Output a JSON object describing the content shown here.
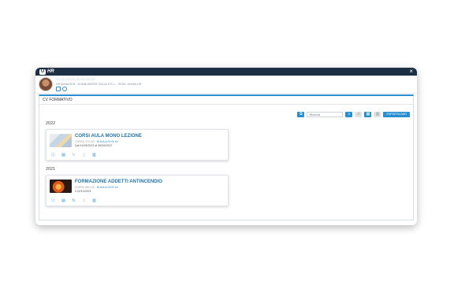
{
  "app": {
    "logo_mark": "U",
    "logo_text": "HR",
    "close": "×"
  },
  "profile": {
    "name": "— — — — — — — —",
    "meta": "HR MANAGER - BOMBONIERIE SALVA S.R.L. - SEDE: ADMIN HR"
  },
  "section": {
    "title": "CV FORMATIVO"
  },
  "toolbar": {
    "search_placeholder": "Ricerca",
    "export_label": "ESPORTA DATI"
  },
  "years": [
    {
      "year": "2022",
      "courses": [
        {
          "title": "CORSI AULA MONO LEZIONE",
          "sub_prefix": "CORSO 17/1.00 · ",
          "sub_mode": "IN AULA 00:00 hh",
          "date": "Dal 01/09/2022 al 30/09/2022"
        }
      ]
    },
    {
      "year": "2021",
      "courses": [
        {
          "title": "FORMAZIONE ADDETTI ANTINCENDIO",
          "sub_prefix": "CORSO 65/1.00 · ",
          "sub_mode": "IN AULA 04:00 hh",
          "date": "Il 02/10/2021"
        }
      ]
    }
  ],
  "icons": [
    "close-icon",
    "avatar",
    "search-icon",
    "filter-icon",
    "info-icon",
    "document-icon",
    "refresh-icon",
    "attachment-icon",
    "delete-icon"
  ],
  "colors": {
    "titlebar": "#1d2f45",
    "accent": "#2a8fd0",
    "title_blue": "#2474a8"
  }
}
